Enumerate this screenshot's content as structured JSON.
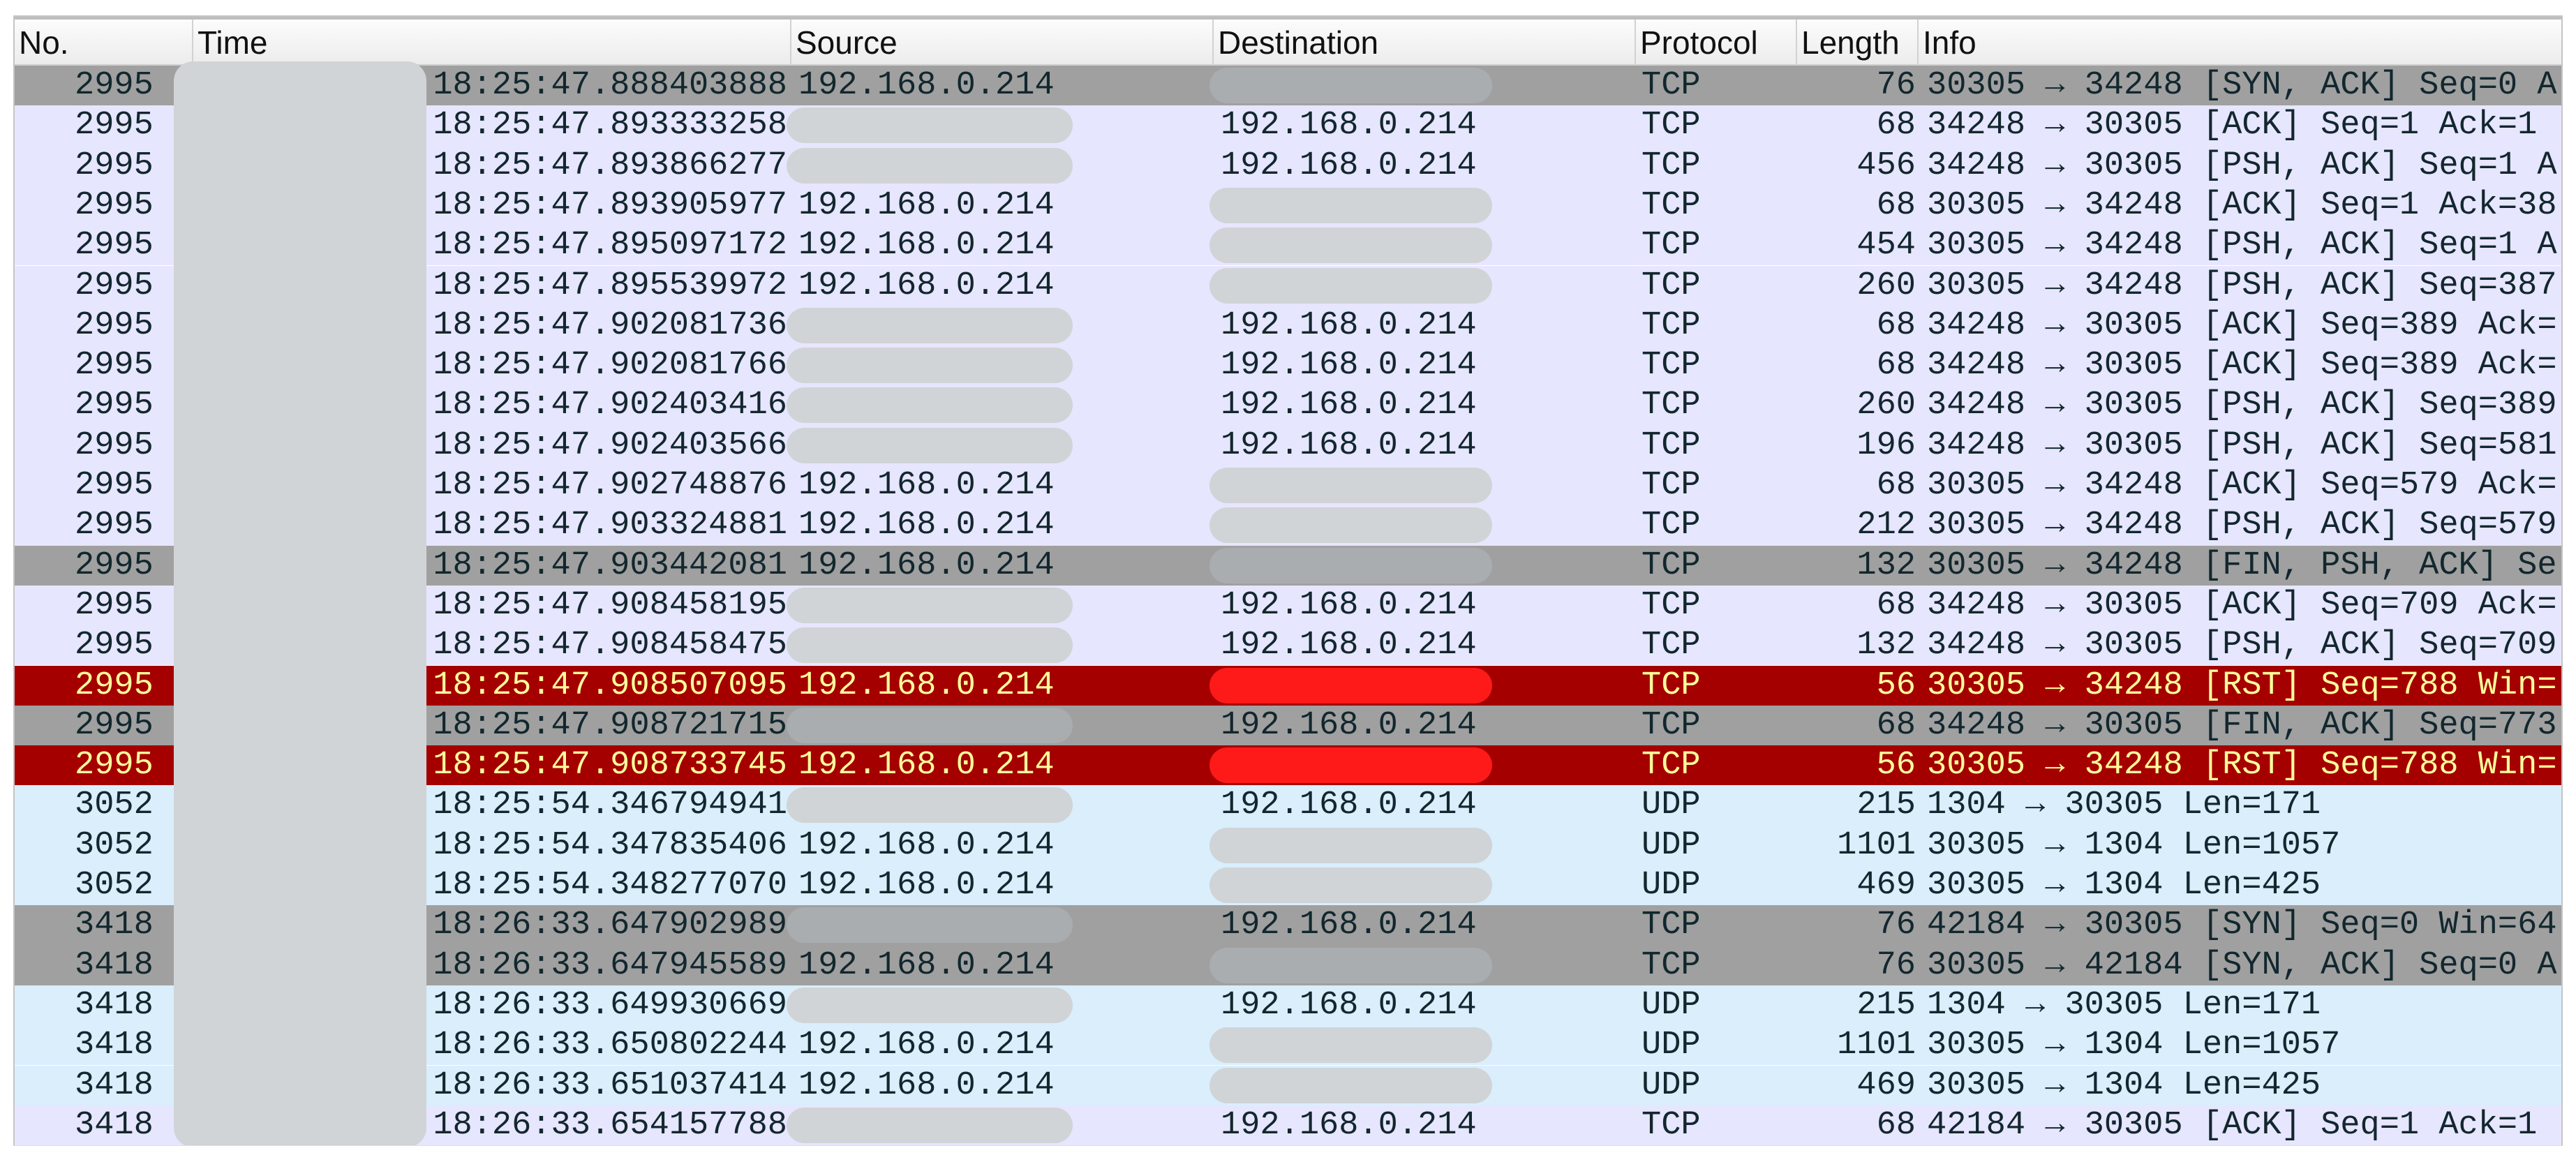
{
  "columns": [
    "No.",
    "Time",
    "Source",
    "Destination",
    "Protocol",
    "Length",
    "Info"
  ],
  "colors": {
    "tcp": "#e7e6ff",
    "udp": "#daeefc",
    "flag": "#a0a0a0",
    "rst": "#a40000",
    "rst_text": "#fffc9c",
    "redaction": "#d0d4d6"
  },
  "rows": [
    {
      "kind": "flag",
      "no": "2995",
      "time": "18:25:47.888403888",
      "src": "192.168.0.214",
      "dst": "",
      "proto": "TCP",
      "len": "76",
      "info": "30305 → 34248 [SYN, ACK] Seq=0 A"
    },
    {
      "kind": "tcp",
      "no": "2995",
      "time": "18:25:47.893333258",
      "src": "",
      "dst": "192.168.0.214",
      "proto": "TCP",
      "len": "68",
      "info": "34248 → 30305 [ACK] Seq=1 Ack=1"
    },
    {
      "kind": "tcp",
      "no": "2995",
      "time": "18:25:47.893866277",
      "src": "",
      "dst": "192.168.0.214",
      "proto": "TCP",
      "len": "456",
      "info": "34248 → 30305 [PSH, ACK] Seq=1 A"
    },
    {
      "kind": "tcp",
      "no": "2995",
      "time": "18:25:47.893905977",
      "src": "192.168.0.214",
      "dst": "",
      "proto": "TCP",
      "len": "68",
      "info": "30305 → 34248 [ACK] Seq=1 Ack=38"
    },
    {
      "kind": "tcp",
      "no": "2995",
      "time": "18:25:47.895097172",
      "src": "192.168.0.214",
      "dst": "",
      "proto": "TCP",
      "len": "454",
      "info": "30305 → 34248 [PSH, ACK] Seq=1 A"
    },
    {
      "kind": "tcp",
      "no": "2995",
      "time": "18:25:47.895539972",
      "src": "192.168.0.214",
      "dst": "",
      "proto": "TCP",
      "len": "260",
      "info": "30305 → 34248 [PSH, ACK] Seq=387"
    },
    {
      "kind": "tcp",
      "no": "2995",
      "time": "18:25:47.902081736",
      "src": "",
      "dst": "192.168.0.214",
      "proto": "TCP",
      "len": "68",
      "info": "34248 → 30305 [ACK] Seq=389 Ack="
    },
    {
      "kind": "tcp",
      "no": "2995",
      "time": "18:25:47.902081766",
      "src": "",
      "dst": "192.168.0.214",
      "proto": "TCP",
      "len": "68",
      "info": "34248 → 30305 [ACK] Seq=389 Ack="
    },
    {
      "kind": "tcp",
      "no": "2995",
      "time": "18:25:47.902403416",
      "src": "",
      "dst": "192.168.0.214",
      "proto": "TCP",
      "len": "260",
      "info": "34248 → 30305 [PSH, ACK] Seq=389"
    },
    {
      "kind": "tcp",
      "no": "2995",
      "time": "18:25:47.902403566",
      "src": "",
      "dst": "192.168.0.214",
      "proto": "TCP",
      "len": "196",
      "info": "34248 → 30305 [PSH, ACK] Seq=581"
    },
    {
      "kind": "tcp",
      "no": "2995",
      "time": "18:25:47.902748876",
      "src": "192.168.0.214",
      "dst": "",
      "proto": "TCP",
      "len": "68",
      "info": "30305 → 34248 [ACK] Seq=579 Ack="
    },
    {
      "kind": "tcp",
      "no": "2995",
      "time": "18:25:47.903324881",
      "src": "192.168.0.214",
      "dst": "",
      "proto": "TCP",
      "len": "212",
      "info": "30305 → 34248 [PSH, ACK] Seq=579"
    },
    {
      "kind": "flag",
      "no": "2995",
      "time": "18:25:47.903442081",
      "src": "192.168.0.214",
      "dst": "",
      "proto": "TCP",
      "len": "132",
      "info": "30305 → 34248 [FIN, PSH, ACK] Se"
    },
    {
      "kind": "tcp",
      "no": "2995",
      "time": "18:25:47.908458195",
      "src": "",
      "dst": "192.168.0.214",
      "proto": "TCP",
      "len": "68",
      "info": "34248 → 30305 [ACK] Seq=709 Ack="
    },
    {
      "kind": "tcp",
      "no": "2995",
      "time": "18:25:47.908458475",
      "src": "",
      "dst": "192.168.0.214",
      "proto": "TCP",
      "len": "132",
      "info": "34248 → 30305 [PSH, ACK] Seq=709"
    },
    {
      "kind": "rst",
      "no": "2995",
      "time": "18:25:47.908507095",
      "src": "192.168.0.214",
      "dst": "",
      "proto": "TCP",
      "len": "56",
      "info": "30305 → 34248 [RST] Seq=788 Win="
    },
    {
      "kind": "flag",
      "no": "2995",
      "time": "18:25:47.908721715",
      "src": "",
      "dst": "192.168.0.214",
      "proto": "TCP",
      "len": "68",
      "info": "34248 → 30305 [FIN, ACK] Seq=773"
    },
    {
      "kind": "rst",
      "no": "2995",
      "time": "18:25:47.908733745",
      "src": "192.168.0.214",
      "dst": "",
      "proto": "TCP",
      "len": "56",
      "info": "30305 → 34248 [RST] Seq=788 Win="
    },
    {
      "kind": "udp",
      "no": "3052",
      "time": "18:25:54.346794941",
      "src": "",
      "dst": "192.168.0.214",
      "proto": "UDP",
      "len": "215",
      "info": "1304 → 30305 Len=171"
    },
    {
      "kind": "udp",
      "no": "3052",
      "time": "18:25:54.347835406",
      "src": "192.168.0.214",
      "dst": "",
      "proto": "UDP",
      "len": "1101",
      "info": "30305 → 1304 Len=1057"
    },
    {
      "kind": "udp",
      "no": "3052",
      "time": "18:25:54.348277070",
      "src": "192.168.0.214",
      "dst": "",
      "proto": "UDP",
      "len": "469",
      "info": "30305 → 1304 Len=425"
    },
    {
      "kind": "flag",
      "no": "3418",
      "time": "18:26:33.647902989",
      "src": "",
      "dst": "192.168.0.214",
      "proto": "TCP",
      "len": "76",
      "info": "42184 → 30305 [SYN] Seq=0 Win=64"
    },
    {
      "kind": "flag",
      "no": "3418",
      "time": "18:26:33.647945589",
      "src": "192.168.0.214",
      "dst": "",
      "proto": "TCP",
      "len": "76",
      "info": "30305 → 42184 [SYN, ACK] Seq=0 A"
    },
    {
      "kind": "udp",
      "no": "3418",
      "time": "18:26:33.649930669",
      "src": "",
      "dst": "192.168.0.214",
      "proto": "UDP",
      "len": "215",
      "info": "1304 → 30305 Len=171"
    },
    {
      "kind": "udp",
      "no": "3418",
      "time": "18:26:33.650802244",
      "src": "192.168.0.214",
      "dst": "",
      "proto": "UDP",
      "len": "1101",
      "info": "30305 → 1304 Len=1057"
    },
    {
      "kind": "udp",
      "no": "3418",
      "time": "18:26:33.651037414",
      "src": "192.168.0.214",
      "dst": "",
      "proto": "UDP",
      "len": "469",
      "info": "30305 → 1304 Len=425"
    },
    {
      "kind": "tcp",
      "no": "3418",
      "time": "18:26:33.654157788",
      "src": "",
      "dst": "192.168.0.214",
      "proto": "TCP",
      "len": "68",
      "info": "42184 → 30305 [ACK] Seq=1 Ack=1"
    }
  ]
}
